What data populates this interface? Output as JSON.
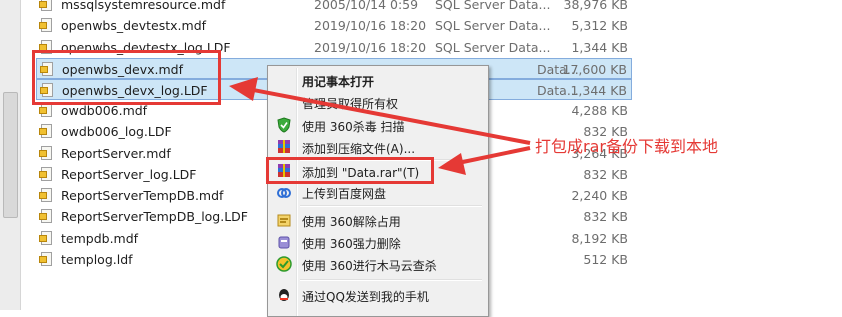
{
  "files": [
    {
      "name": "mssqlsystemresource.mdf",
      "date": "2005/10/14 0:59",
      "type": "SQL Server Data...",
      "size": "38,976 KB",
      "selected": false
    },
    {
      "name": "openwbs_devtestx.mdf",
      "date": "2019/10/16 18:20",
      "type": "SQL Server Data...",
      "size": "5,312 KB",
      "selected": false
    },
    {
      "name": "openwbs_devtestx_log.LDF",
      "date": "2019/10/16 18:20",
      "type": "SQL Server Data...",
      "size": "1,344 KB",
      "selected": false
    },
    {
      "name": "openwbs_devx.mdf",
      "date": "",
      "type": "Data...",
      "size": "17,600 KB",
      "selected": true
    },
    {
      "name": "openwbs_devx_log.LDF",
      "date": "",
      "type": "Data...",
      "size": "1,344 KB",
      "selected": true
    },
    {
      "name": "owdb006.mdf",
      "date": "",
      "type": "",
      "size": "4,288 KB",
      "selected": false
    },
    {
      "name": "owdb006_log.LDF",
      "date": "",
      "type": "",
      "size": "832 KB",
      "selected": false
    },
    {
      "name": "ReportServer.mdf",
      "date": "",
      "type": "",
      "size": "3,264 KB",
      "selected": false
    },
    {
      "name": "ReportServer_log.LDF",
      "date": "",
      "type": "",
      "size": "832 KB",
      "selected": false
    },
    {
      "name": "ReportServerTempDB.mdf",
      "date": "",
      "type": "",
      "size": "2,240 KB",
      "selected": false
    },
    {
      "name": "ReportServerTempDB_log.LDF",
      "date": "",
      "type": "",
      "size": "832 KB",
      "selected": false
    },
    {
      "name": "tempdb.mdf",
      "date": "",
      "type": "",
      "size": "8,192 KB",
      "selected": false
    },
    {
      "name": "templog.ldf",
      "date": "",
      "type": "",
      "size": "512 KB",
      "selected": false
    }
  ],
  "context_menu": {
    "items": [
      {
        "label": "用记事本打开",
        "bold": true,
        "icon": "none"
      },
      {
        "label": "管理员取得所有权",
        "bold": false,
        "icon": "none"
      },
      {
        "label": "使用 360杀毒 扫描",
        "bold": false,
        "icon": "shield-icon"
      },
      {
        "label": "添加到压缩文件(A)...",
        "bold": false,
        "icon": "winrar-icon"
      },
      {
        "label": "添加到 \"Data.rar\"(T)",
        "bold": false,
        "icon": "winrar-icon"
      },
      {
        "label": "上传到百度网盘",
        "bold": false,
        "icon": "baidu-cloud-icon"
      },
      {
        "label": "使用 360解除占用",
        "bold": false,
        "icon": "unlock-icon"
      },
      {
        "label": "使用 360强力删除",
        "bold": false,
        "icon": "shred-icon"
      },
      {
        "label": "使用 360进行木马云查杀",
        "bold": false,
        "icon": "trojan-scan-icon"
      },
      {
        "label": "通过QQ发送到我的手机",
        "bold": false,
        "icon": "qq-icon"
      }
    ]
  },
  "annotation": {
    "text": "打包成rar备份下载到本地"
  },
  "colors": {
    "annotation_red": "#e53935",
    "selection_bg": "#cde6f7"
  }
}
